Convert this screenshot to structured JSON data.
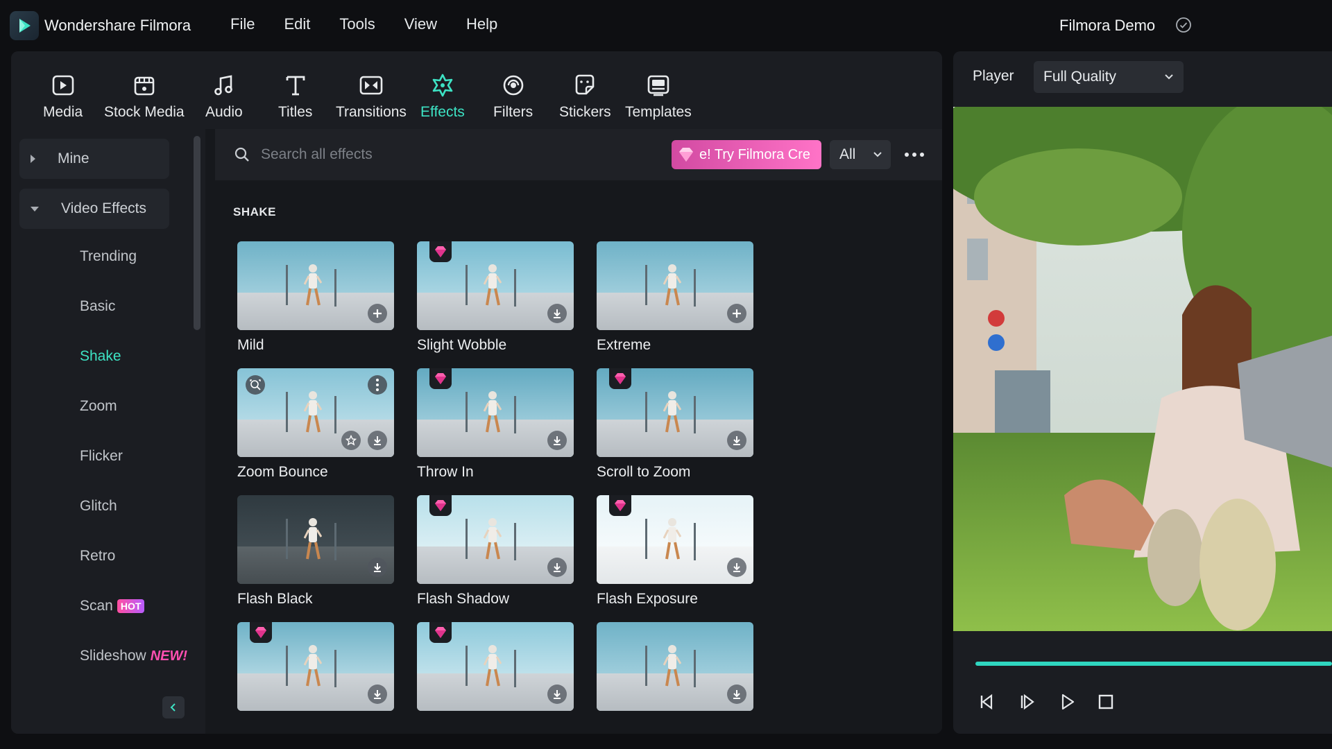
{
  "app": {
    "name": "Wondershare Filmora",
    "project_name": "Filmora Demo"
  },
  "menu": [
    "File",
    "Edit",
    "Tools",
    "View",
    "Help"
  ],
  "toolbar": {
    "items": [
      {
        "label": "Media",
        "icon": "media-icon"
      },
      {
        "label": "Stock Media",
        "icon": "stock-media-icon"
      },
      {
        "label": "Audio",
        "icon": "audio-icon"
      },
      {
        "label": "Titles",
        "icon": "titles-icon"
      },
      {
        "label": "Transitions",
        "icon": "transitions-icon"
      },
      {
        "label": "Effects",
        "icon": "effects-icon"
      },
      {
        "label": "Filters",
        "icon": "filters-icon"
      },
      {
        "label": "Stickers",
        "icon": "stickers-icon"
      },
      {
        "label": "Templates",
        "icon": "templates-icon"
      }
    ],
    "active": "Effects"
  },
  "sidebar": {
    "mine": "Mine",
    "video_effects": "Video Effects",
    "items": [
      {
        "label": "Trending"
      },
      {
        "label": "Basic"
      },
      {
        "label": "Shake"
      },
      {
        "label": "Zoom"
      },
      {
        "label": "Flicker"
      },
      {
        "label": "Glitch"
      },
      {
        "label": "Retro"
      },
      {
        "label": "Scan",
        "badge": "HOT"
      },
      {
        "label": "Slideshow",
        "badge": "NEW!"
      }
    ],
    "active": "Shake"
  },
  "search": {
    "placeholder": "Search all effects",
    "value": "",
    "promo": "e! Try Filmora Cre",
    "filter": "All"
  },
  "section": {
    "title": "SHAKE"
  },
  "effects": [
    {
      "name": "Mild",
      "premium": false,
      "action": "add"
    },
    {
      "name": "Slight Wobble",
      "premium": true,
      "action": "download"
    },
    {
      "name": "Extreme",
      "premium": false,
      "action": "add"
    },
    {
      "name": "Zoom Bounce",
      "premium": false,
      "action": "download",
      "hovered": true
    },
    {
      "name": "Throw In",
      "premium": true,
      "action": "download"
    },
    {
      "name": "Scroll to Zoom",
      "premium": true,
      "action": "download"
    },
    {
      "name": "Flash Black",
      "premium": false,
      "action": "download"
    },
    {
      "name": "Flash Shadow",
      "premium": true,
      "action": "download"
    },
    {
      "name": "Flash Exposure",
      "premium": true,
      "action": "download"
    },
    {
      "name": "",
      "premium": true,
      "action": "download"
    },
    {
      "name": "",
      "premium": true,
      "action": "download"
    },
    {
      "name": "",
      "premium": false,
      "action": "download"
    }
  ],
  "player": {
    "label": "Player",
    "quality": "Full Quality",
    "progress": 1.0
  },
  "colors": {
    "accent": "#3de3c4",
    "premium_pink": "#ff4fa0",
    "background": "#16181c",
    "panel": "#1b1d22"
  }
}
